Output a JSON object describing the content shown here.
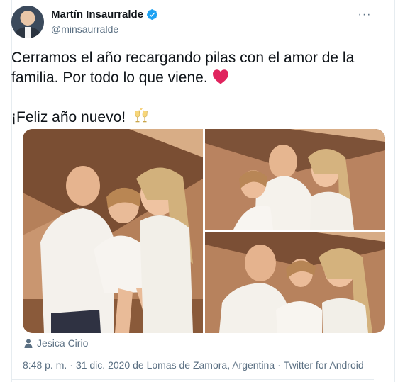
{
  "author": {
    "name": "Martín Insaurralde",
    "handle": "@minsaurralde",
    "verified": true,
    "avatar": "avatar-photo"
  },
  "menu": {
    "icon": "more-options-icon",
    "label": "···"
  },
  "tweet": {
    "line1": "Cerramos el año recargando pilas con el amor de la familia. Por todo lo que viene.",
    "line1_emoji": "red-heart-icon",
    "line2": "¡Feliz año nuevo!",
    "line2_emoji": "clinking-glasses-icon"
  },
  "media": {
    "photos": [
      {
        "name": "family-photo-large",
        "alt": "photo"
      },
      {
        "name": "family-photo-top-right",
        "alt": "photo"
      },
      {
        "name": "family-photo-bottom-right",
        "alt": "photo"
      }
    ],
    "tagged_icon": "person-icon",
    "tagged_user": "Jesica Cirio"
  },
  "meta": {
    "time": "8:48 p. m.",
    "separator": "·",
    "date": "31 dic. 2020",
    "location": "de Lomas de Zamora, Argentina",
    "source": "Twitter for Android"
  },
  "colors": {
    "text": "#0f1419",
    "secondary": "#5b7083",
    "verified": "#1da1f2",
    "heart": "#e0245e",
    "border": "#e6ecf0"
  }
}
